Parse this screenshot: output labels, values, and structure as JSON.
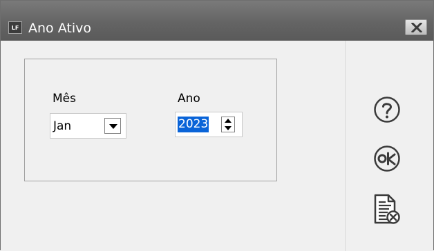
{
  "window": {
    "title": "Ano Ativo",
    "app_icon_text": "LF"
  },
  "form": {
    "month_label": "Mês",
    "month_value": "Jan",
    "year_label": "Ano",
    "year_value": "2023"
  },
  "sidebar": {
    "help_icon": "question-circle-icon",
    "ok_icon": "ok-circle-icon",
    "cancel_icon": "document-cancel-icon"
  },
  "colors": {
    "title_bar": "#646464",
    "selection": "#0a64d8",
    "panel": "#f0f0f0"
  }
}
